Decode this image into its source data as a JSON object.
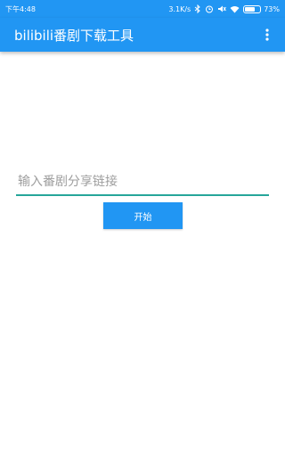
{
  "status_bar": {
    "time": "下午4:48",
    "network_speed": "3.1K/s",
    "battery_percent": "73%",
    "battery_level": 0.73,
    "icons": [
      "bluetooth-icon",
      "alarm-icon",
      "mute-icon",
      "wifi-icon",
      "battery-icon"
    ]
  },
  "app_bar": {
    "title": "bilibili番剧下载工具",
    "menu_icon": "more-vert-icon"
  },
  "main": {
    "link_input": {
      "placeholder": "输入番剧分享链接",
      "value": ""
    },
    "start_button_label": "开始"
  },
  "colors": {
    "primary": "#2196f3",
    "input_underline": "#26a69a"
  }
}
